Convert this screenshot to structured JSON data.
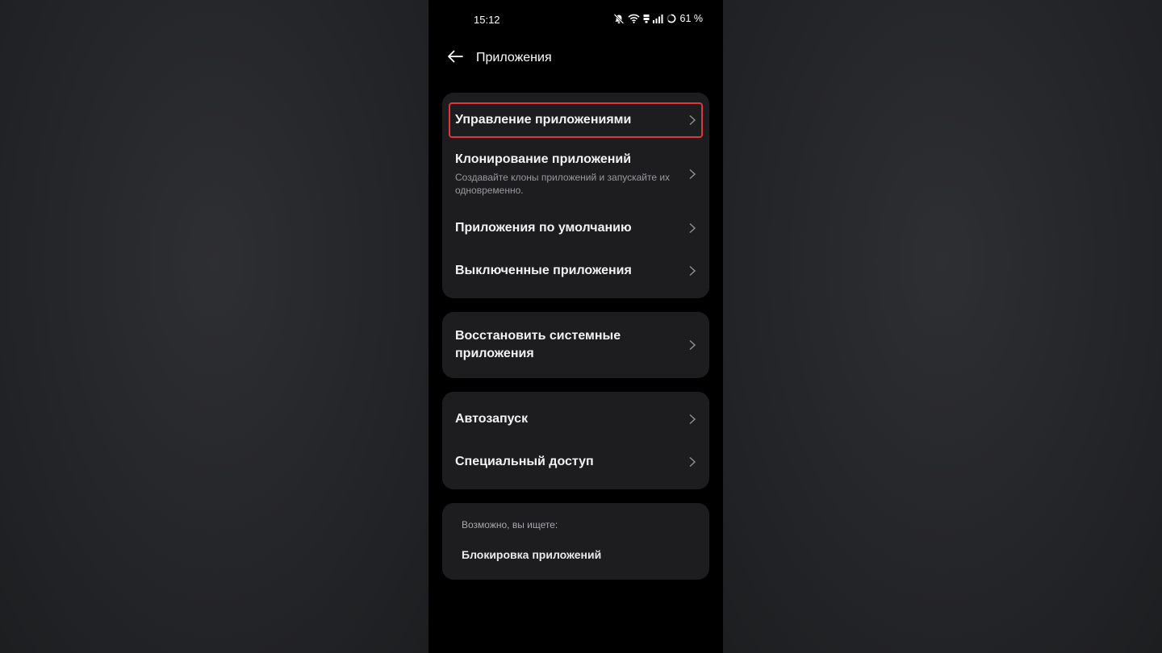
{
  "status_bar": {
    "time": "15:12",
    "battery_text": "61 %",
    "icons": [
      "mute-bell-icon",
      "wifi-icon",
      "network-type-icon",
      "signal-icon",
      "battery-ring-icon"
    ]
  },
  "header": {
    "back_icon": "arrow-left-icon",
    "title": "Приложения"
  },
  "group1": {
    "items": [
      {
        "title": "Управление приложениями",
        "highlighted": true
      },
      {
        "title": "Клонирование приложений",
        "subtitle": "Создавайте клоны приложений и запускайте их одновременно."
      },
      {
        "title": "Приложения по умолчанию"
      },
      {
        "title": "Выключенные приложения"
      }
    ]
  },
  "group2": {
    "items": [
      {
        "title_line1": "Восстановить системные",
        "title_line2": "приложения"
      }
    ]
  },
  "group3": {
    "items": [
      {
        "title": "Автозапуск"
      },
      {
        "title": "Специальный доступ"
      }
    ]
  },
  "suggestions": {
    "label": "Возможно, вы ищете:",
    "link": "Блокировка приложений"
  },
  "colors": {
    "background": "#000000",
    "card": "#1d1d1f",
    "highlight_border": "#e0353b",
    "text_primary": "#f2f2f2",
    "text_secondary": "#9a9a9e"
  }
}
